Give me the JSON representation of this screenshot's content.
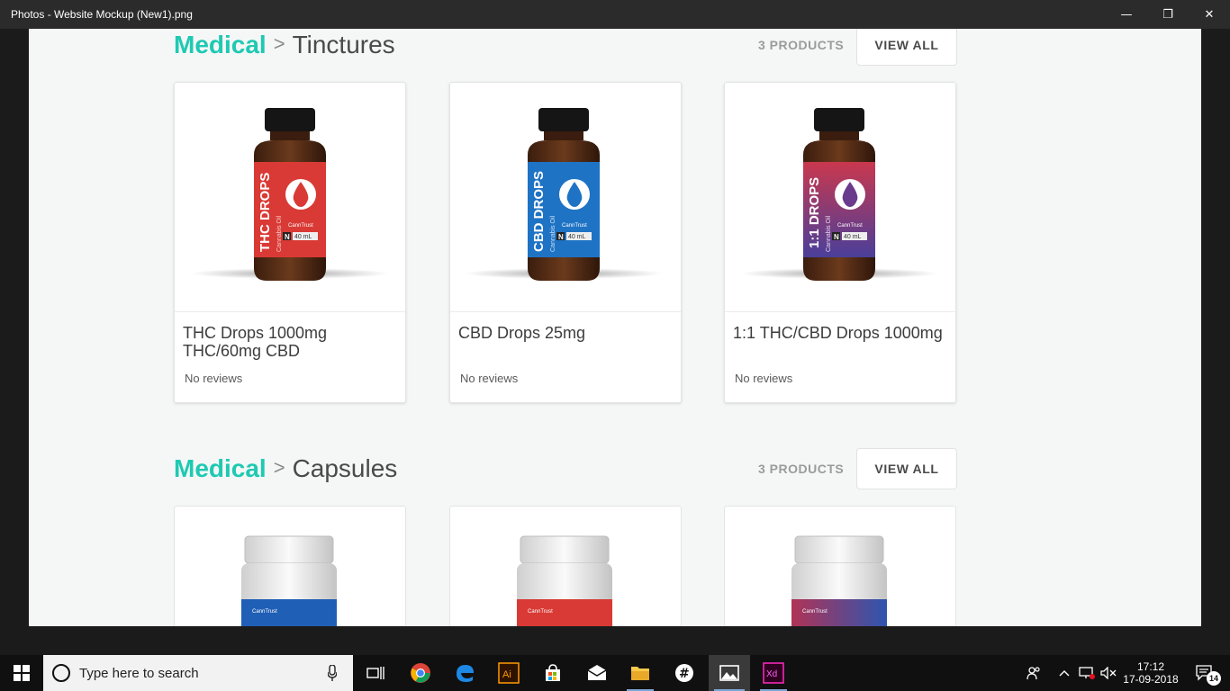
{
  "window": {
    "title": "Photos - Website Mockup (New1).png",
    "minimize_glyph": "—",
    "restore_glyph": "❐",
    "close_glyph": "✕"
  },
  "sections": [
    {
      "category": "Medical",
      "separator": ">",
      "subcategory": "Tinctures",
      "count_label": "3 PRODUCTS",
      "view_all_label": "VIEW ALL",
      "products": [
        {
          "name": "THC Drops 1000mg THC/60mg CBD",
          "reviews": "No reviews",
          "label_big": "THC DROPS",
          "label_small": "Cannabis Oil",
          "brand": "CannTrust",
          "badge": "N",
          "volume": "40 mL",
          "color": "#d93a35"
        },
        {
          "name": "CBD Drops 25mg",
          "reviews": "No reviews",
          "label_big": "CBD DROPS",
          "label_small": "Cannabis Oil",
          "brand": "CannTrust",
          "badge": "N",
          "volume": "40 mL",
          "color": "#1f73c4"
        },
        {
          "name": "1:1 THC/CBD Drops 1000mg",
          "reviews": "No reviews",
          "label_big": "1:1 DROPS",
          "label_small": "Cannabis Oil",
          "brand": "CannTrust",
          "badge": "N",
          "volume": "40 mL",
          "color": "#9c3a6e"
        }
      ]
    },
    {
      "category": "Medical",
      "separator": ">",
      "subcategory": "Capsules",
      "count_label": "3 PRODUCTS",
      "view_all_label": "VIEW ALL",
      "products": [
        {
          "brand": "CannTrust",
          "color": "#1f5fb5"
        },
        {
          "brand": "CannTrust",
          "color": "#d93a35"
        },
        {
          "brand": "CannTrust",
          "color": "#8a3a78"
        }
      ]
    }
  ],
  "taskbar": {
    "search_placeholder": "Type here to search",
    "time": "17:12",
    "date": "17-09-2018",
    "notification_count": "14",
    "apps": [
      "task-view",
      "chrome",
      "edge",
      "illustrator",
      "store",
      "mail",
      "file-explorer",
      "slack",
      "photos",
      "xd"
    ]
  }
}
